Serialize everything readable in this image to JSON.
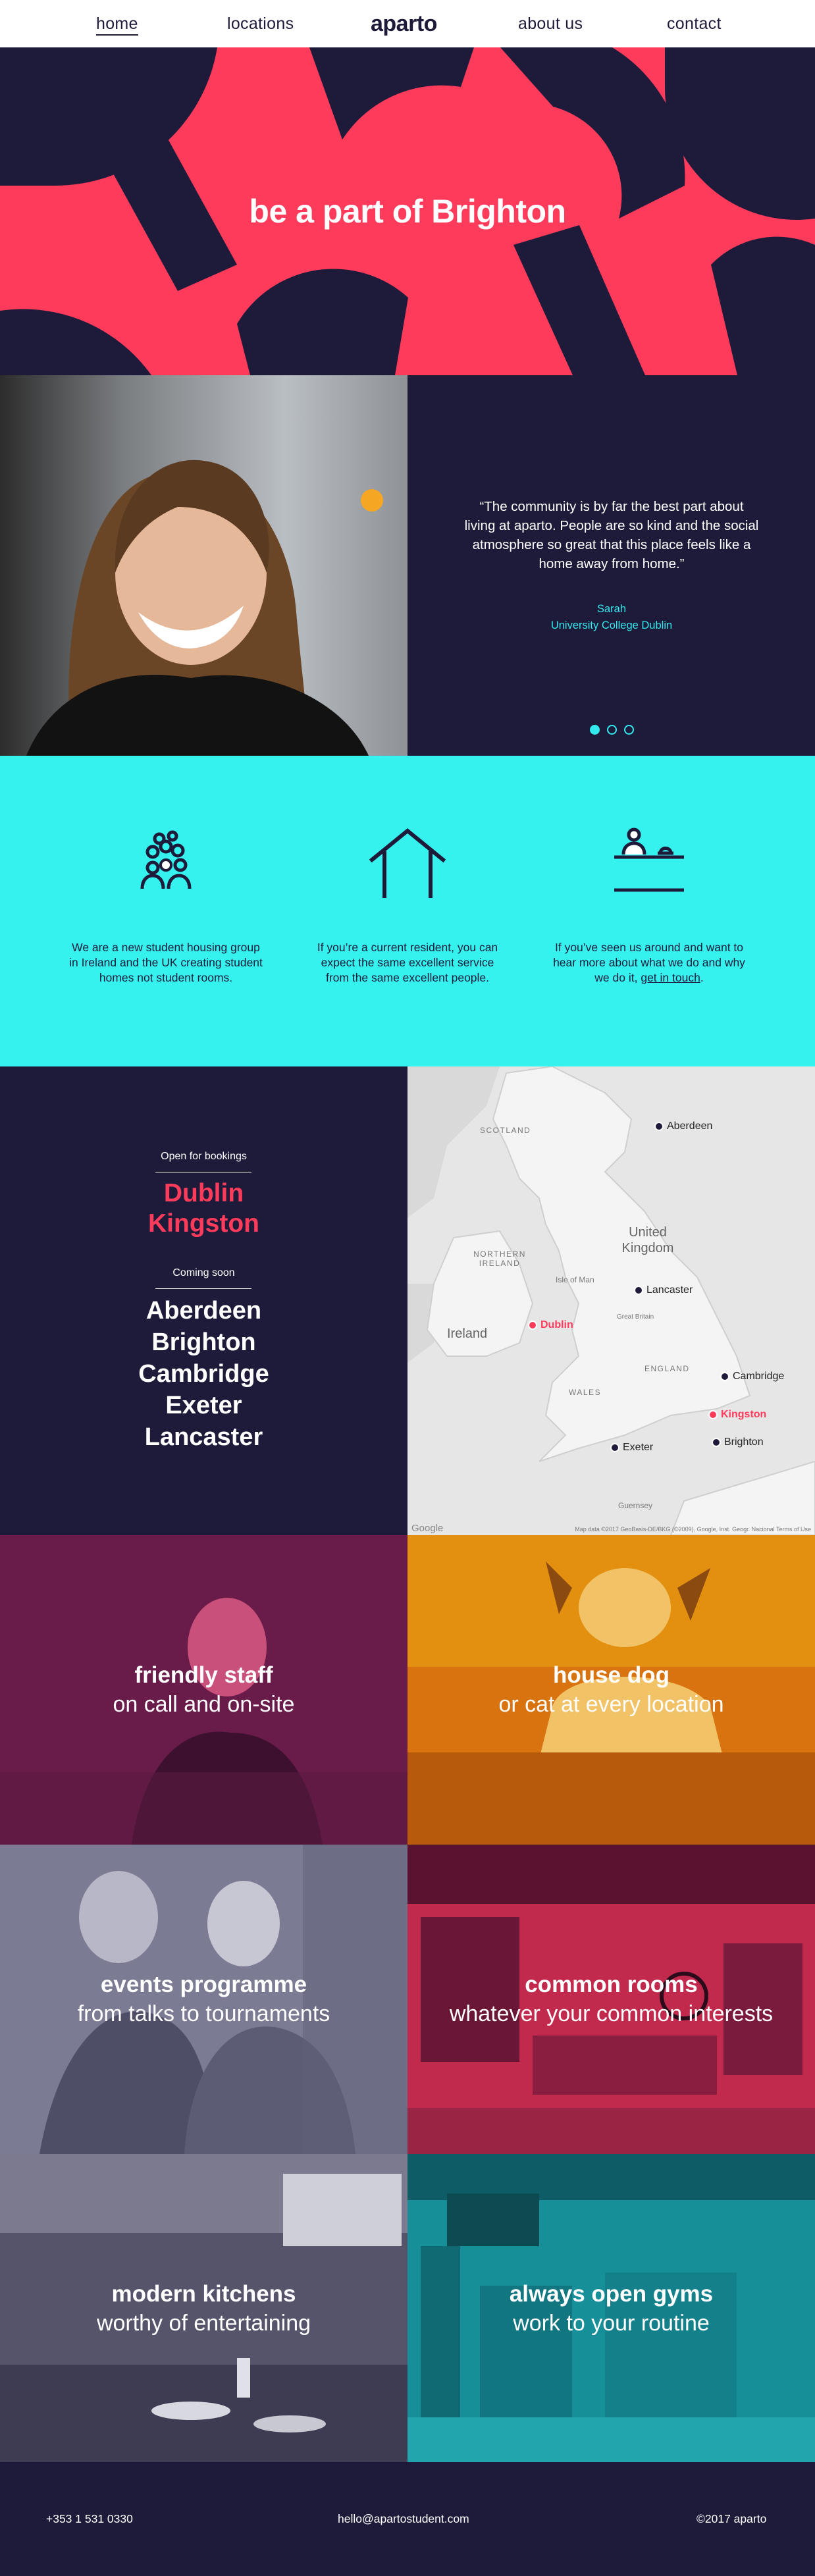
{
  "nav": {
    "home": "home",
    "locations": "locations",
    "logo": "aparto",
    "about": "about us",
    "contact": "contact"
  },
  "hero": {
    "title": "be a part of Brighton"
  },
  "testimonial": {
    "quote": "“The community is by far the best part about living at aparto. People are so kind and the social atmosphere so great that this place feels like a home away from home.”",
    "name": "Sarah",
    "school": "University College Dublin",
    "slides": 3,
    "active_slide": 1
  },
  "features": [
    {
      "icon": "community-icon",
      "text": "We are a new student housing group in Ireland and the UK creating student homes not student rooms."
    },
    {
      "icon": "house-icon",
      "text": "If you’re a current resident, you can expect the same excellent service from the same excellent people."
    },
    {
      "icon": "reception-desk-icon",
      "text_before": "If you’ve seen us around and want to hear more about what we do and why we do it,",
      "link": "get in touch",
      "text_after": "."
    }
  ],
  "locations": {
    "open_label": "Open for bookings",
    "open": [
      "Dublin",
      "Kingston"
    ],
    "soon_label": "Coming soon",
    "soon": [
      "Aberdeen",
      "Brighton",
      "Cambridge",
      "Exeter",
      "Lancaster"
    ]
  },
  "map": {
    "cities": [
      "Aberdeen",
      "Lancaster",
      "Dublin",
      "Cambridge",
      "Kingston",
      "Exeter",
      "Brighton"
    ],
    "regions": [
      "SCOTLAND",
      "NORTHERN IRELAND",
      "ENGLAND",
      "WALES"
    ],
    "countries": [
      "United Kingdom",
      "Ireland"
    ],
    "places": [
      "Isle of Man",
      "Guernsey",
      "Great Britain"
    ],
    "google": "Google",
    "credit": "Map data ©2017 GeoBasis-DE/BKG (©2009), Google, Inst. Geogr. Nacional",
    "terms": "Terms of Use"
  },
  "tiles": [
    {
      "title": "friendly staff",
      "sub": "on call and on-site",
      "tint": "#7a1f52"
    },
    {
      "title": "house dog",
      "sub": "or cat at every location",
      "tint": "#d9730f"
    },
    {
      "title": "events programme",
      "sub": "from talks to tournaments",
      "tint": "#7b7b93"
    },
    {
      "title": "common rooms",
      "sub": "whatever your common interests",
      "tint": "#c22a4d"
    },
    {
      "title": "modern kitchens",
      "sub": "worthy of entertaining",
      "tint": "#56546b"
    },
    {
      "title": "always open gyms",
      "sub": "work to your routine",
      "tint": "#178f99"
    }
  ],
  "footer": {
    "phone": "+353 1 531 0330",
    "email": "hello@apartostudent.com",
    "copyright": "©2017 aparto"
  },
  "colors": {
    "navy": "#1e1b3a",
    "coral": "#ff3b5c",
    "cyan": "#35f2ef"
  }
}
